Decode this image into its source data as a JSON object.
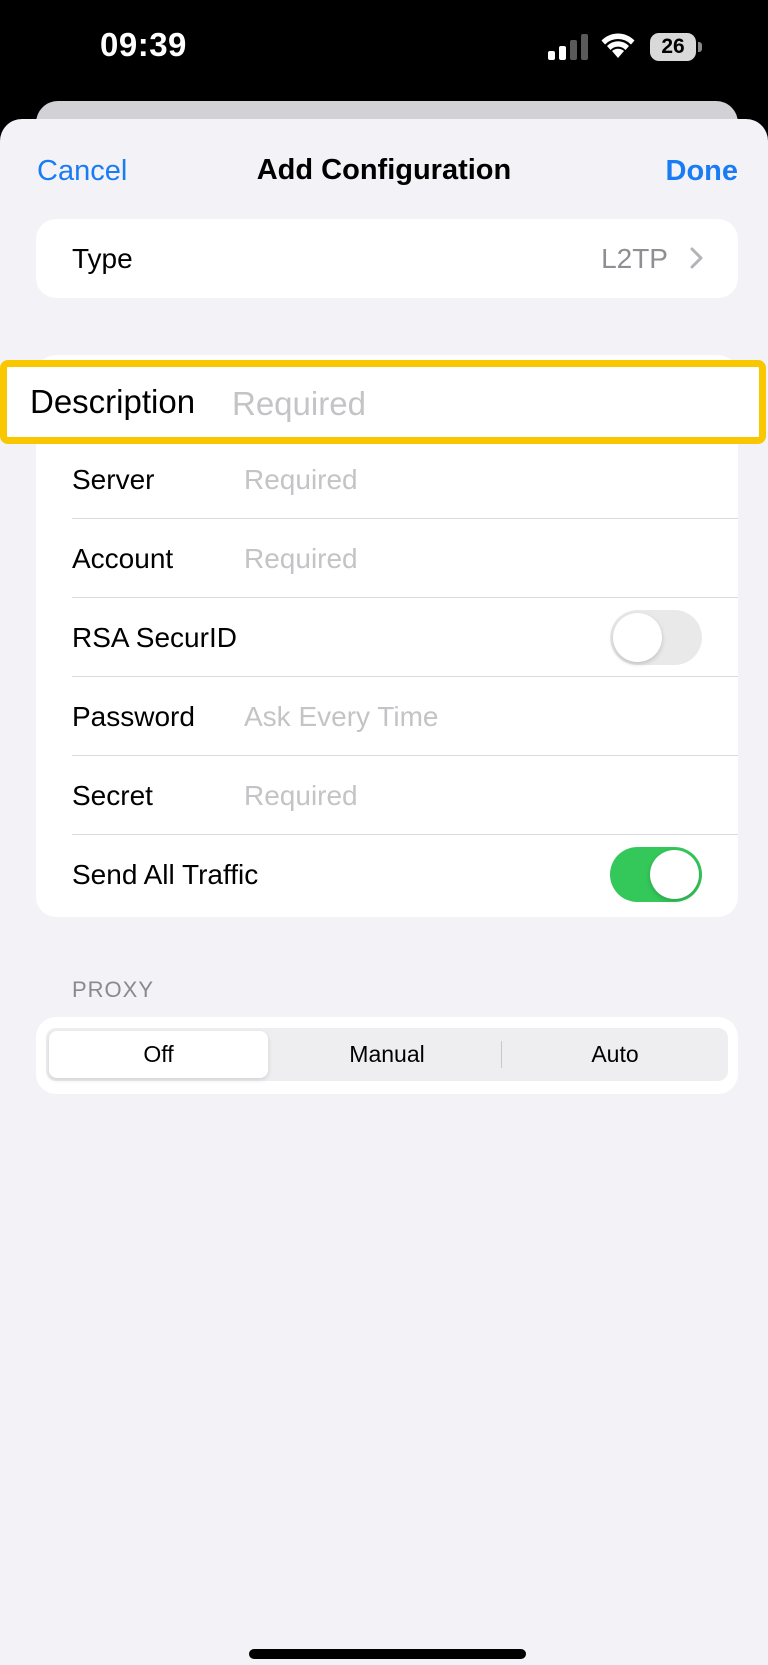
{
  "status_bar": {
    "time": "09:39",
    "battery_level": "26",
    "signal_icon": "cellular-signal-icon",
    "wifi_icon": "wifi-icon",
    "battery_icon": "battery-icon"
  },
  "nav": {
    "cancel_label": "Cancel",
    "title": "Add Configuration",
    "done_label": "Done"
  },
  "type_row": {
    "label": "Type",
    "value": "L2TP"
  },
  "description_row": {
    "label": "Description",
    "placeholder": "Required"
  },
  "fields": {
    "server": {
      "label": "Server",
      "placeholder": "Required"
    },
    "account": {
      "label": "Account",
      "placeholder": "Required"
    },
    "rsa": {
      "label": "RSA SecurID",
      "enabled": false
    },
    "password": {
      "label": "Password",
      "placeholder": "Ask Every Time"
    },
    "secret": {
      "label": "Secret",
      "placeholder": "Required"
    },
    "send_all_traffic": {
      "label": "Send All Traffic",
      "enabled": true
    }
  },
  "proxy": {
    "header": "PROXY",
    "options": [
      "Off",
      "Manual",
      "Auto"
    ],
    "selected": "Off"
  },
  "colors": {
    "accent": "#1a7cf5",
    "highlight": "#f9c700",
    "toggle_on": "#34c759"
  }
}
